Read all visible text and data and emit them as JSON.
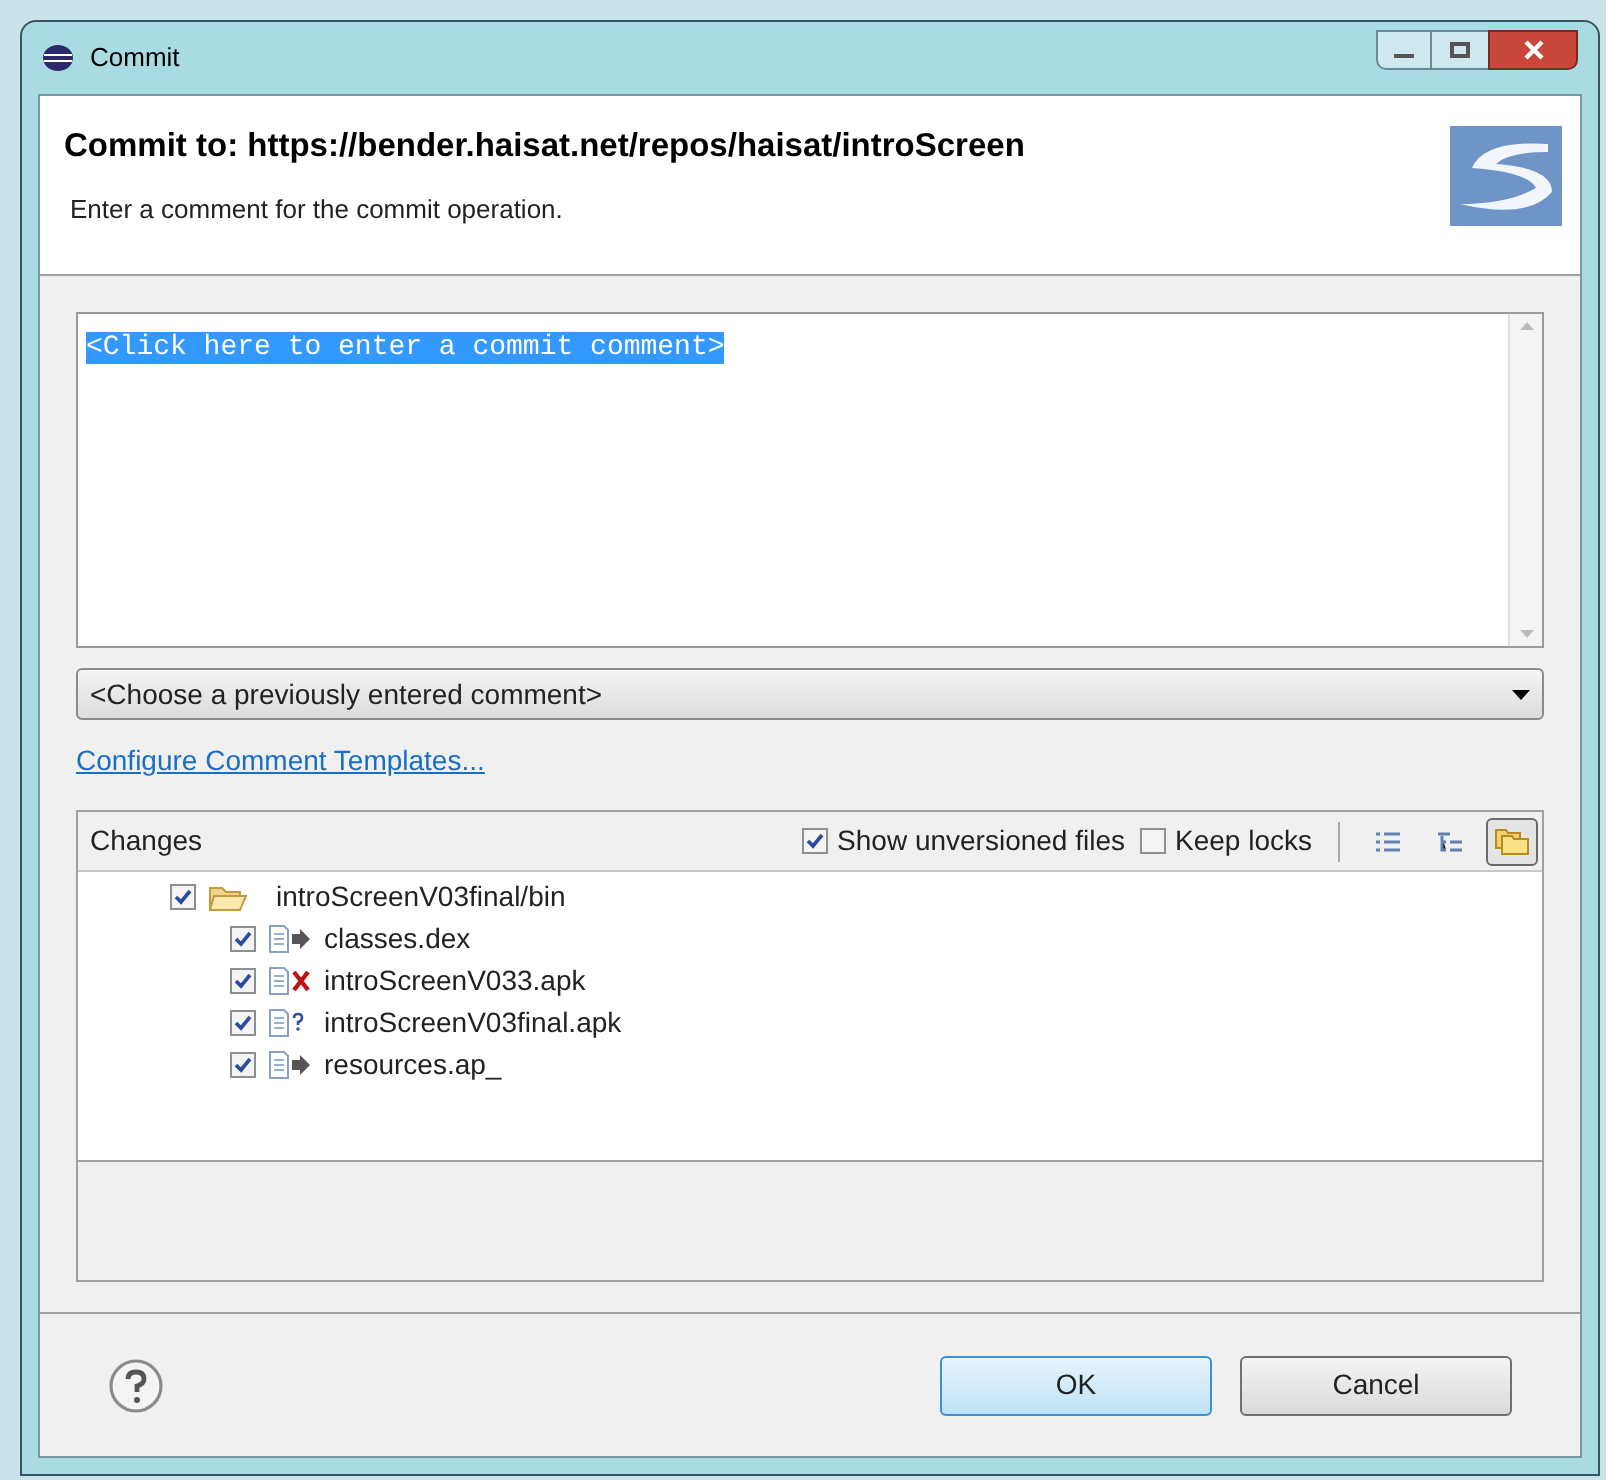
{
  "window": {
    "title": "Commit"
  },
  "header": {
    "title": "Commit to: https://bender.haisat.net/repos/haisat/introScreen",
    "subtitle": "Enter a comment for the commit operation."
  },
  "comment": {
    "value": "<Click here to enter a commit comment>",
    "selected": true
  },
  "previous_comments": {
    "value": "<Choose a previously entered comment>"
  },
  "templates_link": "Configure Comment Templates...",
  "changes": {
    "label": "Changes",
    "options": [
      {
        "label": "Show unversioned files",
        "checked": true
      },
      {
        "label": "Keep locks",
        "checked": false
      }
    ],
    "view_buttons": [
      {
        "kind": "flat",
        "selected": false
      },
      {
        "kind": "tree",
        "selected": false
      },
      {
        "kind": "compressed",
        "selected": true
      }
    ],
    "tree": [
      {
        "name": "introScreenV03final/bin",
        "kind": "folder",
        "checked": true,
        "children": [
          {
            "name": "classes.dex",
            "kind": "outgoing",
            "checked": true
          },
          {
            "name": "introScreenV033.apk",
            "kind": "deleted",
            "checked": true
          },
          {
            "name": "introScreenV03final.apk",
            "kind": "unversioned",
            "checked": true
          },
          {
            "name": "resources.ap_",
            "kind": "outgoing",
            "checked": true
          }
        ]
      }
    ]
  },
  "buttons": [
    {
      "label": "OK",
      "kind": "default"
    },
    {
      "label": "Cancel",
      "kind": "normal"
    }
  ]
}
